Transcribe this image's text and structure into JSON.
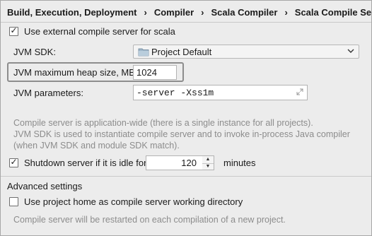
{
  "breadcrumb": [
    "Build, Execution, Deployment",
    "Compiler",
    "Scala Compiler",
    "Scala Compile Server"
  ],
  "use_external": {
    "label": "Use external compile server for scala",
    "checked": true
  },
  "jvm_sdk": {
    "label": "JVM SDK:",
    "value": "Project Default"
  },
  "heap": {
    "label": "JVM maximum heap size, MB:",
    "value": "1024"
  },
  "jvm_params": {
    "label": "JVM parameters:",
    "value": "-server -Xss1m"
  },
  "info": [
    "Compile server is application-wide (there is a single instance for all projects).",
    "JVM SDK is used to instantiate compile server and to invoke in-process Java compiler",
    "(when JVM SDK and module SDK match)."
  ],
  "shutdown": {
    "label": "Shutdown server if it is idle for",
    "value": "120",
    "unit": "minutes",
    "checked": true
  },
  "advanced": {
    "title": "Advanced settings",
    "use_project_home": {
      "label": "Use project home as compile server working directory",
      "checked": false
    },
    "note": "Compile server will be restarted on each compilation of a new project."
  }
}
